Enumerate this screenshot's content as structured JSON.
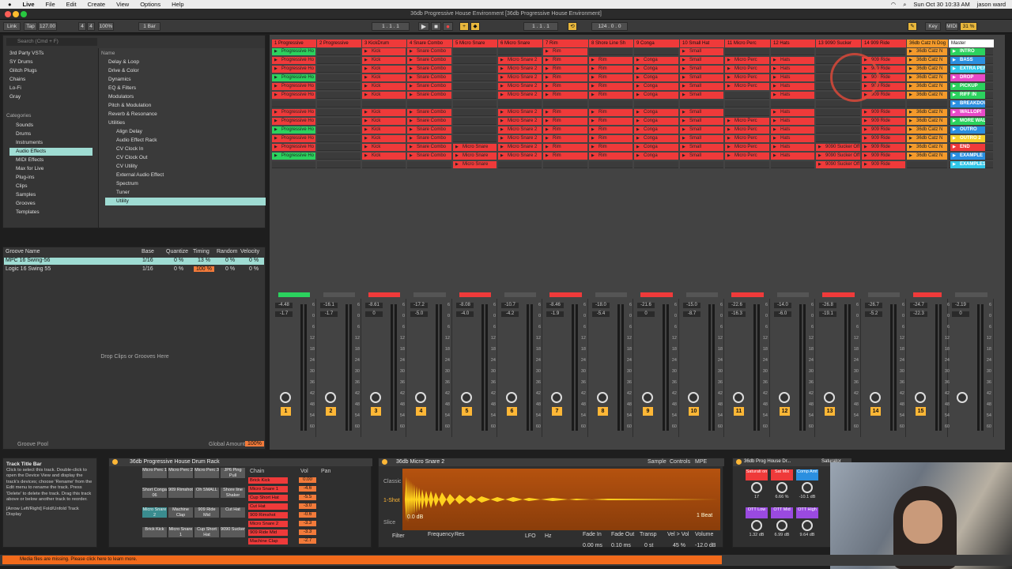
{
  "menubar": {
    "app": "Live",
    "items": [
      "File",
      "Edit",
      "Create",
      "View",
      "Options",
      "Help"
    ],
    "clock": "Sun Oct 30  10:33 AM",
    "user": "jason ward"
  },
  "window": {
    "title": "36db Progressive House Environment  [36db Progressive House Environment]"
  },
  "controlbar": {
    "link": "Link",
    "tap": "Tap",
    "tempo": "127.00",
    "sig_num": "4",
    "sig_den": "4",
    "zoom": "100%",
    "quantize": "1 Bar",
    "position": "1 . 1 . 1",
    "loop_start": "1 . 1 . 1",
    "loop_len": "124 . 0 . 0",
    "key": "Key",
    "midi": "MIDI",
    "cpu": "31 %"
  },
  "browser": {
    "search_placeholder": "Search (Cmd + F)",
    "collections": [
      "3rd Party VSTs",
      "SY Drums",
      "Glitch Plugs",
      "Chains",
      "Lo-Fi",
      "Gray"
    ],
    "categories_label": "Categories",
    "categories": [
      "Sounds",
      "Drums",
      "Instruments",
      "Audio Effects",
      "MIDI Effects",
      "Max for Live",
      "Plug-ins",
      "Clips",
      "Samples",
      "Grooves",
      "Templates"
    ],
    "name_header": "Name",
    "items": [
      "Delay & Loop",
      "Drive & Color",
      "Dynamics",
      "EQ & Filters",
      "Modulators",
      "Pitch & Modulation",
      "Reverb & Resonance",
      "Utilities",
      "Align Delay",
      "Audio Effect Rack",
      "CV Clock In",
      "CV Clock Out",
      "CV Utility",
      "External Audio Effect",
      "Spectrum",
      "Tuner",
      "Utility"
    ]
  },
  "groove": {
    "headers": [
      "Groove Name",
      "Base",
      "Quantize",
      "Timing",
      "Random",
      "Velocity"
    ],
    "rows": [
      {
        "name": "MPC 16 Swing-56",
        "base": "1/16",
        "quantize": "0 %",
        "timing": "13 %",
        "random": "0 %",
        "velocity": "0 %"
      },
      {
        "name": "Logic 16 Swing 55",
        "base": "1/16",
        "quantize": "0 %",
        "timing": "100 %",
        "random": "0 %",
        "velocity": "0 %"
      }
    ],
    "drop_hint": "Drop Clips or Grooves Here",
    "pool": "Groove Pool",
    "global_amount_label": "Global Amount",
    "global_amount": "100%"
  },
  "tracks": [
    {
      "name": "1 Progressive",
      "color": "#ef3a3a",
      "clip": "Progressive Ho",
      "vol": "-4.48",
      "pan": "-1.7",
      "num": "1"
    },
    {
      "name": "2 Progressive",
      "color": "#ef3a3a",
      "clip": "",
      "vol": "-16.1",
      "pan": "-1.7",
      "num": "2"
    },
    {
      "name": "3 KickDrum",
      "color": "#ef3a3a",
      "clip": "Kick",
      "vol": "-8.61",
      "pan": "0",
      "num": "3"
    },
    {
      "name": "4 Snare Combo",
      "color": "#ef3a3a",
      "clip": "Snare Combo",
      "vol": "-17.2",
      "pan": "-5.0",
      "num": "4"
    },
    {
      "name": "5 Micro Snare",
      "color": "#ef3a3a",
      "clip": "Micro Snare",
      "vol": "-8.08",
      "pan": "-4.0",
      "num": "5"
    },
    {
      "name": "6 Micro Snare",
      "color": "#ef3a3a",
      "clip": "Micro Snare 2",
      "vol": "-10.7",
      "pan": "-4.2",
      "num": "6"
    },
    {
      "name": "7 Rim",
      "color": "#ef3a3a",
      "clip": "Rim",
      "vol": "-8.46",
      "pan": "-1.9",
      "num": "7"
    },
    {
      "name": "8 Shore Line Sh",
      "color": "#ef3a3a",
      "clip": "Rim",
      "vol": "-18.0",
      "pan": "-5.4",
      "num": "8"
    },
    {
      "name": "9 Conga",
      "color": "#ef3a3a",
      "clip": "Conga",
      "vol": "-21.6",
      "pan": "0",
      "num": "9"
    },
    {
      "name": "10 Small Hat",
      "color": "#ef3a3a",
      "clip": "Small",
      "vol": "-15.0",
      "pan": "-8.7",
      "num": "10"
    },
    {
      "name": "11 Micro Perc",
      "color": "#ef3a3a",
      "clip": "Micro Perc",
      "vol": "-22.6",
      "pan": "-16.3",
      "num": "11"
    },
    {
      "name": "12 Hats",
      "color": "#ef3a3a",
      "clip": "Hats",
      "vol": "-14.0",
      "pan": "-6.0",
      "num": "12"
    },
    {
      "name": "13 9090 Sucker",
      "color": "#ef3a3a",
      "clip": "9090 Sucker Off",
      "vol": "-26.8",
      "pan": "-19.1",
      "num": "13"
    },
    {
      "name": "14 909 Ride",
      "color": "#ef3a3a",
      "clip": "909 Ride",
      "vol": "-26.7",
      "pan": "-5.2",
      "num": "14"
    },
    {
      "name": "36db Catz N Dog",
      "color": "#f49a2b",
      "clip": "36db Catz N",
      "vol": "-24.7",
      "pan": "-22.3",
      "num": "15"
    },
    {
      "name": "Master",
      "color": "#ffffff",
      "clip": "",
      "vol": "-2.19",
      "pan": "0",
      "num": ""
    }
  ],
  "scenes": [
    "INTRO",
    "BASS",
    "EXTRA PER",
    "DROP",
    "PICKUP",
    "RIFF IN",
    "BREAKDOW",
    "WALLOP!",
    "MORE WALL",
    "OUTRO",
    "OUTRO 2",
    "END",
    "EXAMPLE",
    "EXAMPLE1"
  ],
  "scene_colors": [
    "#2bd25e",
    "#2b8fe0",
    "#31c7e8",
    "#e84ac8",
    "#2bd25e",
    "#2bd25e",
    "#2b8fe0",
    "#e84ac8",
    "#2bd25e",
    "#2b8fe0",
    "#f5d12b",
    "#ef3a3a",
    "#2b8fe0",
    "#31c7e8"
  ],
  "scale": [
    "6",
    "0",
    "6",
    "12",
    "18",
    "24",
    "30",
    "36",
    "42",
    "48",
    "54",
    "60"
  ],
  "info": {
    "title": "Track Title Bar",
    "text": "Click to select this track. Double-click to open the Device View and display the track's devices; choose 'Rename' from the Edit menu to rename the track. Press 'Delete' to delete the track. Drag this track above or below another track to reorder.",
    "shortcut": "[Arrow Left/Right] Fold/Unfold Track Display"
  },
  "rack": {
    "title": "36db Progressive House Drum Rack",
    "pads": [
      "Micro Perc 1",
      "Micro Perc 2",
      "Micro Perc 3",
      "JP6 Ping Pull",
      "Short Conga 06",
      "909 Rimshot",
      "Oh SMALL",
      "Shore line Shaker",
      "Micro Snare 2",
      "Machine Clap",
      "909 Ride Mid",
      "Cut Hat",
      "Brick Kick",
      "Micro Snare 1",
      "Cup Short Hat",
      "9090 Sucker"
    ],
    "chain_label": "Chain",
    "vol_label": "Vol",
    "pan_label": "Pan",
    "chains": [
      {
        "name": "Brick Kick",
        "vol": "0.00"
      },
      {
        "name": "Micro Snare 1",
        "vol": "-4.6"
      },
      {
        "name": "Cup Short Hat",
        "vol": "-5.5"
      },
      {
        "name": "Cut Hat",
        "vol": "-3.0"
      },
      {
        "name": "909 Rimshot",
        "vol": "-0.6"
      },
      {
        "name": "Micro Snare 2",
        "vol": "-3.3"
      },
      {
        "name": "909 Ride Mid",
        "vol": "-3.3"
      },
      {
        "name": "Machine Clap",
        "vol": "-2.7"
      }
    ]
  },
  "sampler": {
    "title": "36db Micro Snare 2",
    "tabs": [
      "Sample",
      "Controls",
      "MPE"
    ],
    "modes": [
      "Classic",
      "1-Shot",
      "Slice"
    ],
    "gain": "0.0 dB",
    "beats": "1 Beat",
    "labels": [
      "Filter",
      "Frequency",
      "Res",
      "LFO",
      "Hz",
      "Fade In",
      "Fade Out",
      "Transp",
      "Vel > Vol",
      "Volume"
    ],
    "values": [
      "0.00 ms",
      "0.10 ms",
      "0 st",
      "45 %",
      "-12.0 dB"
    ]
  },
  "saturator": {
    "title": "Saturator",
    "rack_title": "36db Prog House Dr...",
    "macros": [
      "Saturati on",
      "Sat Mix",
      "Comp Amt",
      "OTT Low",
      "OTT Mid",
      "OTT High"
    ],
    "values": [
      "17",
      "6.66 %",
      "-10.1 dB",
      "1.32 dB",
      "6.99 dB",
      "9.64 dB"
    ]
  },
  "status": {
    "message": "Media files are missing. Please click here to learn more."
  }
}
